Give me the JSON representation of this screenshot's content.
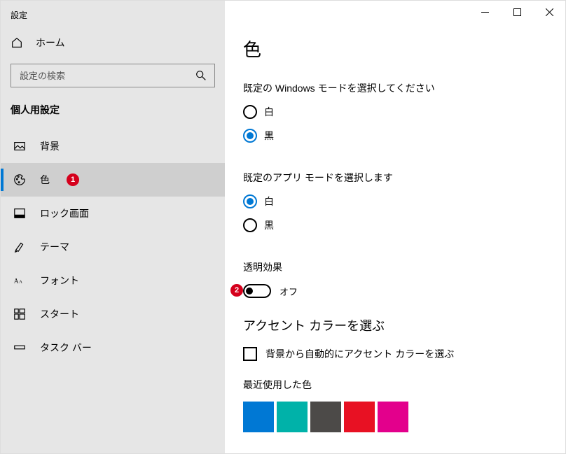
{
  "window": {
    "title": "設定"
  },
  "sidebar": {
    "home_label": "ホーム",
    "search_placeholder": "設定の検索",
    "section_label": "個人用設定",
    "items": [
      {
        "label": "背景"
      },
      {
        "label": "色"
      },
      {
        "label": "ロック画面"
      },
      {
        "label": "テーマ"
      },
      {
        "label": "フォント"
      },
      {
        "label": "スタート"
      },
      {
        "label": "タスク バー"
      }
    ]
  },
  "annotations": {
    "badge1": "1",
    "badge2": "2"
  },
  "page": {
    "title": "色",
    "win_mode_label": "既定の Windows モードを選択してください",
    "win_mode_options": {
      "light": "白",
      "dark": "黒"
    },
    "app_mode_label": "既定のアプリ モードを選択します",
    "app_mode_options": {
      "light": "白",
      "dark": "黒"
    },
    "transparency_label": "透明効果",
    "transparency_state": "オフ",
    "accent_heading": "アクセント カラーを選ぶ",
    "accent_auto_label": "背景から自動的にアクセント カラーを選ぶ",
    "recent_label": "最近使用した色",
    "recent_colors": [
      "#0078d4",
      "#00b2a9",
      "#4c4a48",
      "#e81123",
      "#e3008c"
    ]
  }
}
